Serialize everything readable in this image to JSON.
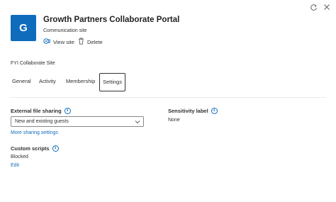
{
  "site": {
    "initial": "G",
    "title": "Growth Partners Collaborate Portal",
    "subtitle": "Communication site",
    "view_label": "View site",
    "delete_label": "Delete",
    "name": "FYI Collaborate Site",
    "tile_color": "#0f6cbd"
  },
  "tabs": [
    "General",
    "Activity",
    "Membership",
    "Settings"
  ],
  "active_tab": "Settings",
  "settings": {
    "external_sharing": {
      "label": "External file sharing",
      "selected": "New and existing guests",
      "more_link": "More sharing settings"
    },
    "sensitivity": {
      "label": "Sensitivity label",
      "value": "None"
    },
    "custom_scripts": {
      "label": "Custom scripts",
      "value": "Blocked",
      "edit_link": "Edit"
    }
  },
  "colors": {
    "accent": "#0f6cbd",
    "text": "#323130"
  },
  "icons": [
    "refresh-icon",
    "close-icon",
    "view-site-icon",
    "delete-icon",
    "info-icon",
    "chevron-down-icon"
  ]
}
